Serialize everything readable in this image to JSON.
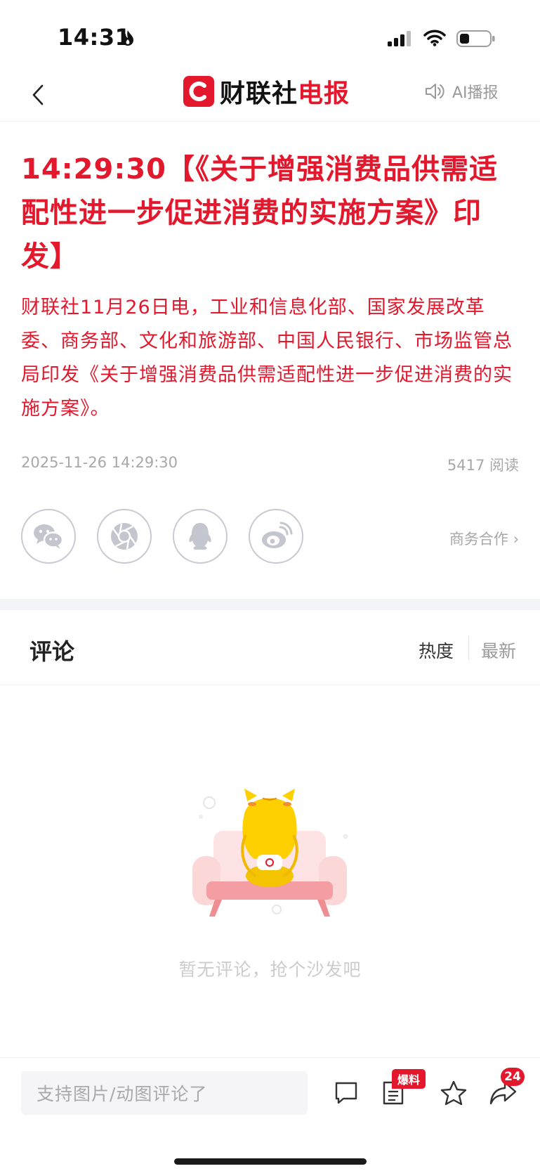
{
  "status_bar": {
    "time": "14:31"
  },
  "nav": {
    "logo_text_black": "财联社",
    "logo_text_red": "电报",
    "ai_play_label": "AI播报"
  },
  "article": {
    "headline": "14:29:30【《关于增强消费品供需适配性进一步促进消费的实施方案》印发】",
    "body": "财联社11月26日电，工业和信息化部、国家发展改革委、商务部、文化和旅游部、中国人民银行、市场监管总局印发《关于增强消费品供需适配性进一步促进消费的实施方案》。",
    "publish_time": "2025-11-26 14:29:30",
    "reads": "5417 阅读",
    "business_link": "商务合作 ›"
  },
  "share": {
    "icons": [
      "wechat-icon",
      "moments-icon",
      "qq-icon",
      "weibo-icon"
    ]
  },
  "comments": {
    "title": "评论",
    "sort_hot": "热度",
    "sort_new": "最新",
    "empty_text": "暂无评论，抢个沙发吧"
  },
  "bottom_bar": {
    "input_placeholder": "支持图片/动图评论了",
    "tip_badge": "爆料",
    "share_count": "24"
  },
  "colors": {
    "accent": "#e3182d",
    "muted": "#a8a8a8"
  }
}
